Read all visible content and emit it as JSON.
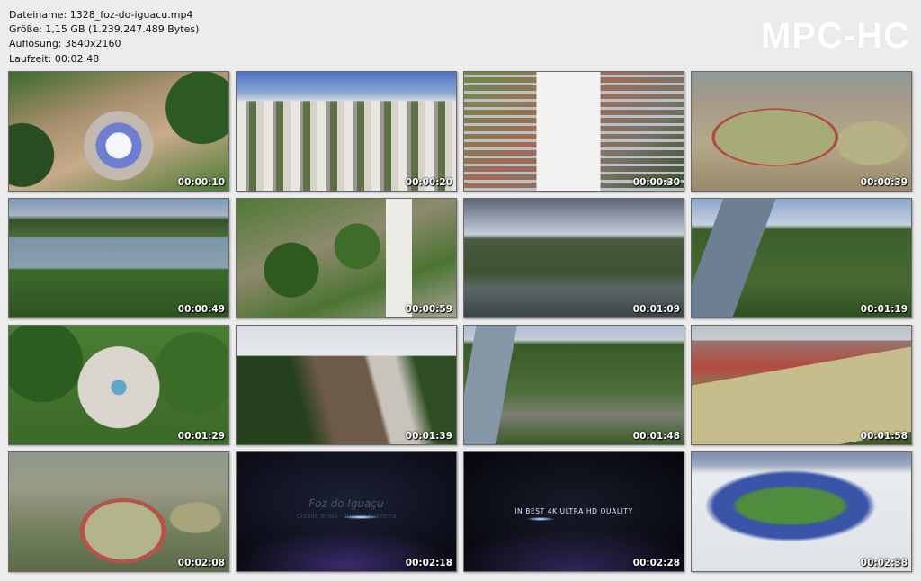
{
  "file_info": {
    "filename_line": "Dateiname: 1328_foz-do-iguacu.mp4",
    "size_line": "Größe: 1,15 GB (1.239.247.489 Bytes)",
    "resolution_line": "Auflösung: 3840x2160",
    "duration_line": "Laufzeit: 00:02:48"
  },
  "logo": "MPC-HC",
  "thumbnails": [
    {
      "time": "00:00:10"
    },
    {
      "time": "00:00:20"
    },
    {
      "time": "00:00:30"
    },
    {
      "time": "00:00:39"
    },
    {
      "time": "00:00:49"
    },
    {
      "time": "00:00:59"
    },
    {
      "time": "00:01:09"
    },
    {
      "time": "00:01:19"
    },
    {
      "time": "00:01:29"
    },
    {
      "time": "00:01:39"
    },
    {
      "time": "00:01:48"
    },
    {
      "time": "00:01:58"
    },
    {
      "time": "00:02:08"
    },
    {
      "time": "00:02:18",
      "overlay_title": "Foz do Iguaçu",
      "overlay_sub": "Cidade Brasil · Tríplice Fronteira"
    },
    {
      "time": "00:02:28",
      "overlay_title": "IN BEST 4K ULTRA HD QUALITY"
    },
    {
      "time": "00:02:38"
    }
  ]
}
